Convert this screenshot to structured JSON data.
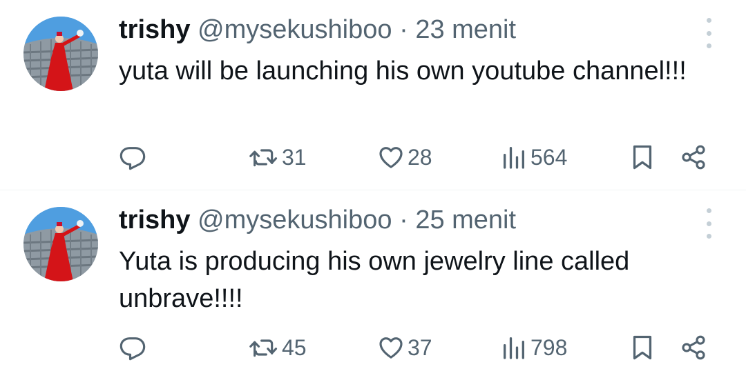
{
  "colors": {
    "text_primary": "#0f1419",
    "text_secondary": "#536471",
    "divider": "#eff3f4",
    "more_dots": "#c4cfd6"
  },
  "tweets": [
    {
      "display_name": "trishy",
      "handle": "@mysekushiboo",
      "separator": "·",
      "time": "23 menit",
      "text": "yuta will be launching his own youtube channel!!!",
      "reposts": "31",
      "likes": "28",
      "views": "564",
      "icons": [
        "reply-icon",
        "repost-icon",
        "like-icon",
        "views-icon",
        "bookmark-icon",
        "share-icon",
        "more-icon"
      ]
    },
    {
      "display_name": "trishy",
      "handle": "@mysekushiboo",
      "separator": "·",
      "time": "25 menit",
      "text": "Yuta is producing his own jewelry line called unbrave!!!!",
      "reposts": "45",
      "likes": "37",
      "views": "798",
      "icons": [
        "reply-icon",
        "repost-icon",
        "like-icon",
        "views-icon",
        "bookmark-icon",
        "share-icon",
        "more-icon"
      ]
    }
  ]
}
